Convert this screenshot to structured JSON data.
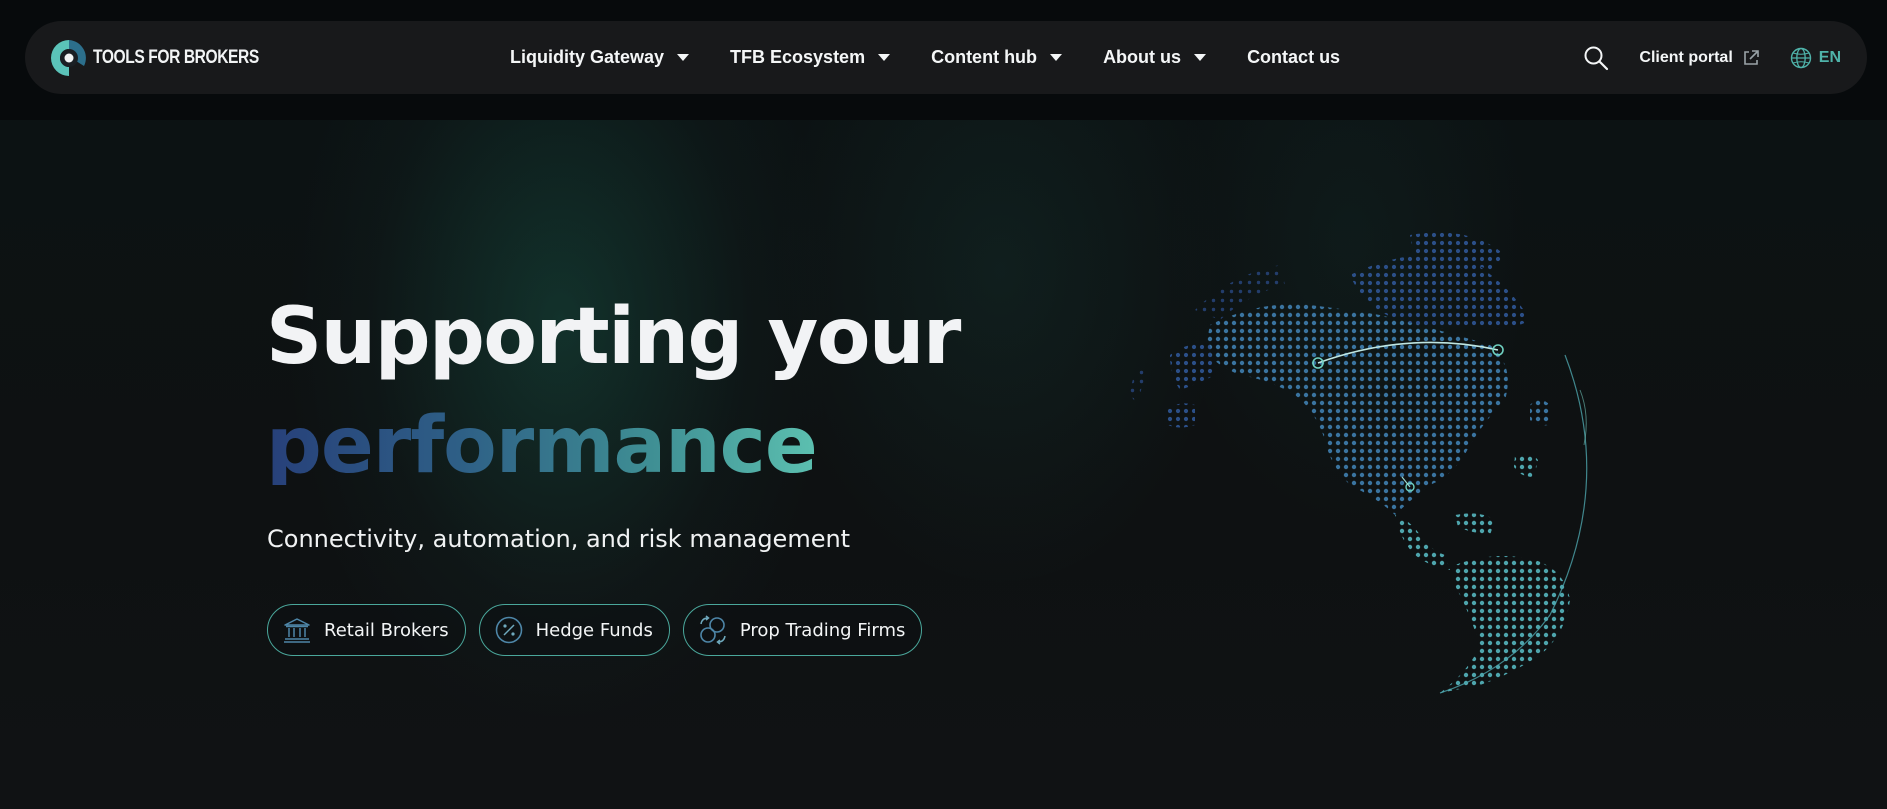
{
  "brand": {
    "logo_text": "TOOLS FOR BROKERS",
    "logo_icon": "tfb-logo-icon",
    "accent_color": "#4fb3aa"
  },
  "nav": {
    "items": [
      {
        "label": "Liquidity Gateway",
        "has_dropdown": true
      },
      {
        "label": "TFB Ecosystem",
        "has_dropdown": true
      },
      {
        "label": "Content hub",
        "has_dropdown": true
      },
      {
        "label": "About us",
        "has_dropdown": true
      },
      {
        "label": "Contact us",
        "has_dropdown": false
      }
    ],
    "search_icon": "search-icon",
    "client_portal": {
      "label": "Client portal",
      "icon": "external-link-icon"
    },
    "language": {
      "label": "EN",
      "icon": "globe-icon"
    }
  },
  "hero": {
    "title": "Supporting your",
    "title_accent": "performance",
    "subtitle": "Connectivity, automation, and risk management",
    "pills": [
      {
        "label": "Retail Brokers",
        "icon": "bank-icon"
      },
      {
        "label": "Hedge Funds",
        "icon": "percent-icon"
      },
      {
        "label": "Prop Trading Firms",
        "icon": "exchange-icon"
      }
    ],
    "graphic": "dotted-globe-icon"
  }
}
